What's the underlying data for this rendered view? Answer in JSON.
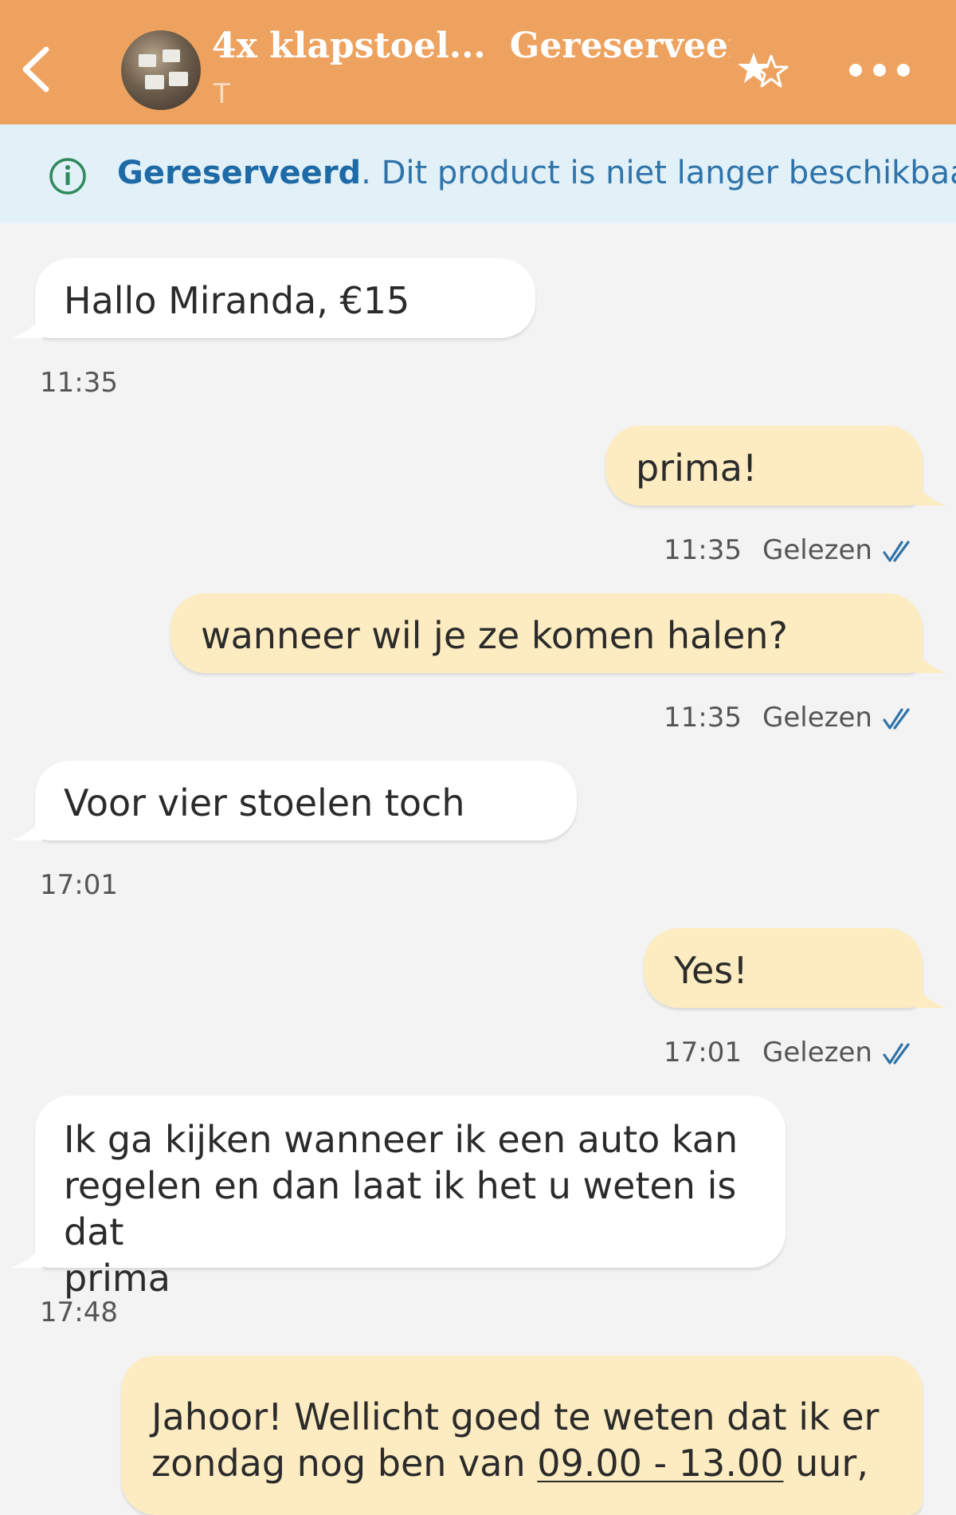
{
  "header": {
    "title": "4x klapstoel...",
    "status": "Gereserveerd",
    "subtitle": "T",
    "back_icon": "chevron-left-icon",
    "favorite_icon": "star-icon",
    "more_icon": "more-horizontal-icon",
    "background_color": "#eea25f"
  },
  "banner": {
    "bold_text": "Gereserveerd",
    "text": ". Dit product is niet langer beschikbaar.",
    "icon": "info-icon",
    "background_color": "#e2f0f8"
  },
  "messages": [
    {
      "direction": "in",
      "text": "Hallo Miranda,  €15",
      "time": "11:35"
    },
    {
      "direction": "out",
      "text": "prima!",
      "time": "11:35",
      "status": "Gelezen"
    },
    {
      "direction": "out",
      "text": "wanneer wil je ze komen halen?",
      "time": "11:35",
      "status": "Gelezen"
    },
    {
      "direction": "in",
      "text": "Voor vier stoelen toch",
      "time": "17:01"
    },
    {
      "direction": "out",
      "text": "Yes!",
      "time": "17:01",
      "status": "Gelezen"
    },
    {
      "direction": "in",
      "lines": [
        "Ik ga kijken wanneer ik een auto kan",
        "regelen en dan laat ik het u weten is dat",
        "prima"
      ],
      "time": "17:48"
    },
    {
      "direction": "out",
      "line1": "Jahoor! Wellicht goed te weten dat ik er",
      "line2_pre": "zondag nog ben van ",
      "line2_link": "09.00 - 13.00",
      "line2_post": " uur,"
    }
  ]
}
